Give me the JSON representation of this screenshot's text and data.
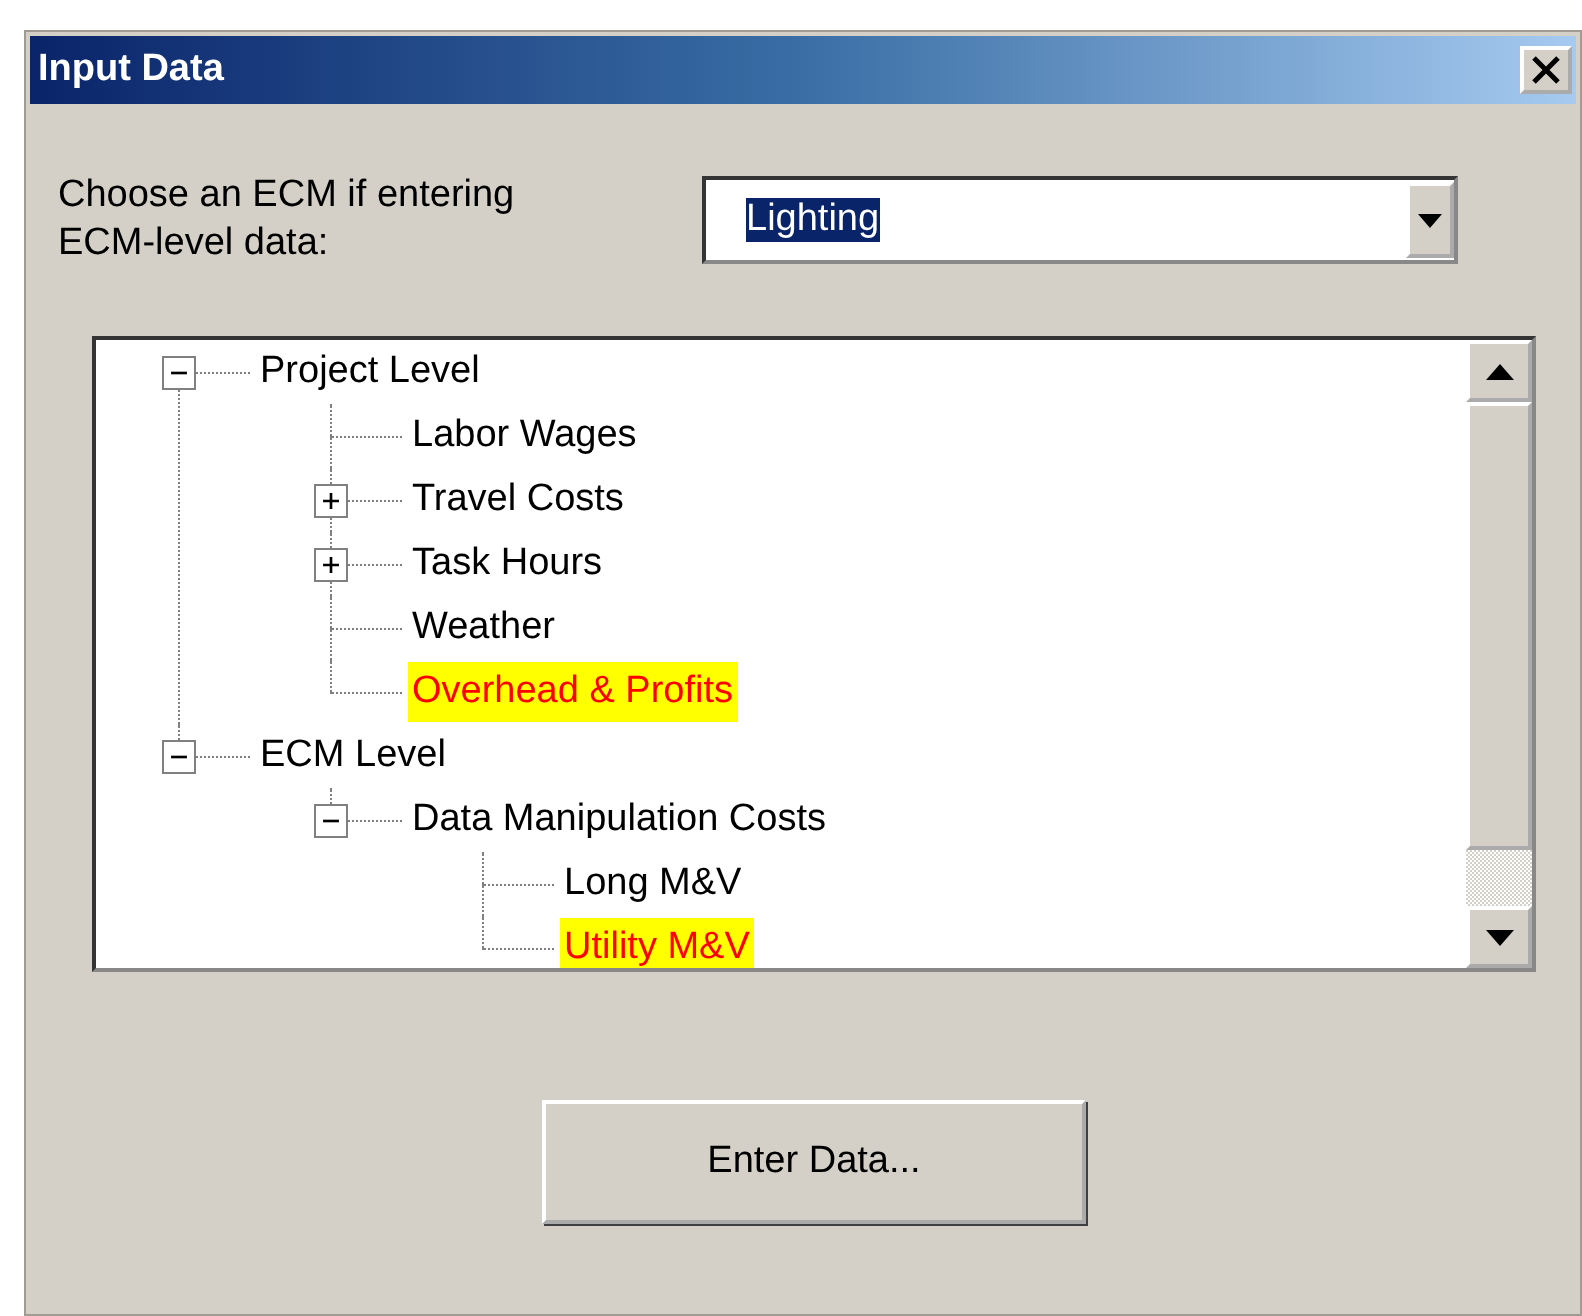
{
  "window": {
    "title": "Input Data"
  },
  "ecm_select": {
    "label": "Choose an ECM if entering ECM-level data:",
    "value": "Lighting"
  },
  "tree": [
    {
      "label": "Project Level",
      "expanded": true,
      "highlighted": false,
      "children": [
        {
          "label": "Labor Wages",
          "highlighted": false
        },
        {
          "label": "Travel Costs",
          "expanded": false,
          "highlighted": false
        },
        {
          "label": "Task Hours",
          "expanded": false,
          "highlighted": false
        },
        {
          "label": "Weather",
          "highlighted": false
        },
        {
          "label": "Overhead & Profits",
          "highlighted": true
        }
      ]
    },
    {
      "label": "ECM Level",
      "expanded": true,
      "highlighted": false,
      "children": [
        {
          "label": "Data Manipulation Costs",
          "expanded": true,
          "highlighted": false,
          "children": [
            {
              "label": "Long M&V",
              "highlighted": false
            },
            {
              "label": "Utility M&V",
              "highlighted": true
            }
          ]
        }
      ]
    }
  ],
  "buttons": [
    "Enter Data..."
  ]
}
